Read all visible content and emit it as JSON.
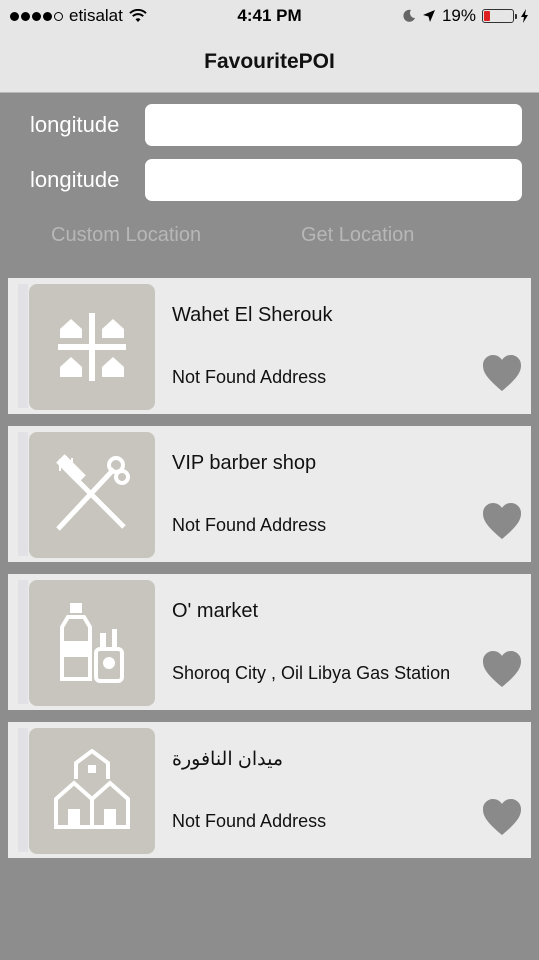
{
  "status_bar": {
    "carrier": "etisalat",
    "time": "4:41 PM",
    "battery": "19%"
  },
  "nav": {
    "title": "FavouritePOI"
  },
  "form": {
    "fields": [
      {
        "label": "longitude",
        "value": ""
      },
      {
        "label": "longitude",
        "value": ""
      }
    ],
    "custom_location": "Custom Location",
    "get_location": "Get Location"
  },
  "places": [
    {
      "name": "Wahet El Sherouk",
      "address": "Not Found Address",
      "icon": "houses-quadrant-icon"
    },
    {
      "name": "VIP barber shop",
      "address": "Not Found Address",
      "icon": "comb-scissors-icon"
    },
    {
      "name": "O' market",
      "address": "Shoroq City , Oil Libya Gas Station",
      "icon": "bottle-lighter-icon"
    },
    {
      "name": "ميدان النافورة",
      "address": "Not Found Address",
      "icon": "houses-cluster-icon"
    }
  ],
  "colors": {
    "background": "#8d8d8d",
    "card": "#ebebeb",
    "thumb": "#c7c5bd",
    "heart": "#8a8a8a",
    "bar": "#e6e6e6"
  }
}
